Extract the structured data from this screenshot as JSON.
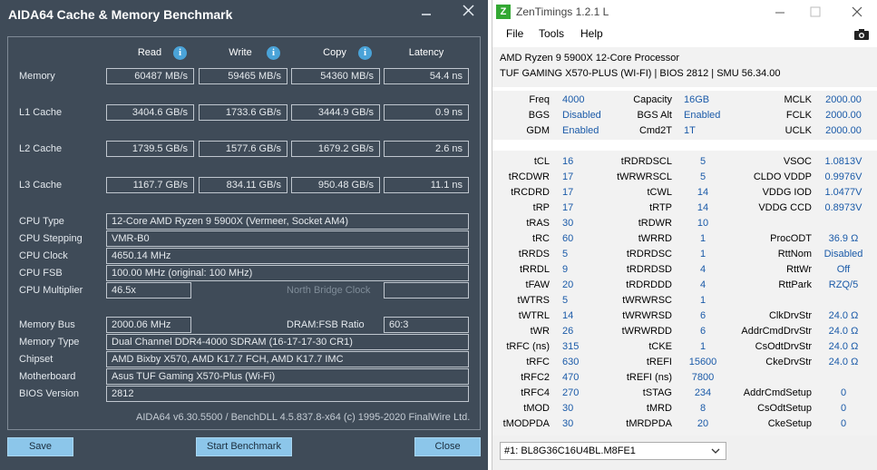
{
  "aida": {
    "title": "AIDA64 Cache & Memory Benchmark",
    "columns": {
      "read": "Read",
      "write": "Write",
      "copy": "Copy",
      "latency": "Latency"
    },
    "info_glyph": "i",
    "rows": [
      {
        "label": "Memory",
        "read": "60487 MB/s",
        "write": "59465 MB/s",
        "copy": "54360 MB/s",
        "latency": "54.4 ns"
      },
      {
        "label": "L1 Cache",
        "read": "3404.6 GB/s",
        "write": "1733.6 GB/s",
        "copy": "3444.9 GB/s",
        "latency": "0.9 ns"
      },
      {
        "label": "L2 Cache",
        "read": "1739.5 GB/s",
        "write": "1577.6 GB/s",
        "copy": "1679.2 GB/s",
        "latency": "2.6 ns"
      },
      {
        "label": "L3 Cache",
        "read": "1167.7 GB/s",
        "write": "834.11 GB/s",
        "copy": "950.48 GB/s",
        "latency": "11.1 ns"
      }
    ],
    "cpu": {
      "type_label": "CPU Type",
      "type": "12-Core AMD Ryzen 9 5900X  (Vermeer, Socket AM4)",
      "stepping_label": "CPU Stepping",
      "stepping": "VMR-B0",
      "clock_label": "CPU Clock",
      "clock": "4650.14 MHz",
      "fsb_label": "CPU FSB",
      "fsb": "100.00 MHz  (original: 100 MHz)",
      "mult_label": "CPU Multiplier",
      "mult": "46.5x",
      "nb_label": "North Bridge Clock"
    },
    "mem": {
      "bus_label": "Memory Bus",
      "bus": "2000.06 MHz",
      "ratio_label": "DRAM:FSB Ratio",
      "ratio": "60:3",
      "type_label": "Memory Type",
      "type": "Dual Channel DDR4-4000 SDRAM  (16-17-17-30 CR1)",
      "chipset_label": "Chipset",
      "chipset": "AMD Bixby X570, AMD K17.7 FCH, AMD K17.7 IMC",
      "mobo_label": "Motherboard",
      "mobo": "Asus TUF Gaming X570-Plus (Wi-Fi)",
      "bios_label": "BIOS Version",
      "bios": "2812"
    },
    "footer": "AIDA64 v6.30.5500 / BenchDLL 4.5.837.8-x64  (c) 1995-2020 FinalWire Ltd.",
    "buttons": {
      "save": "Save",
      "start": "Start Benchmark",
      "close": "Close"
    },
    "colors": {
      "bg": "#3f4b58",
      "button": "#8cc6ea",
      "info": "#4aa3d8"
    }
  },
  "zen": {
    "title": "ZenTimings 1.2.1 L",
    "logo": "Z",
    "menu": [
      "File",
      "Tools",
      "Help"
    ],
    "cpu": "AMD Ryzen 9 5900X 12-Core Processor",
    "board": "TUF GAMING X570-PLUS (WI-FI) | BIOS 2812 | SMU 56.34.00",
    "top": [
      {
        "l1": "Freq",
        "v1": "4000",
        "l2": "Capacity",
        "v2": "16GB",
        "l3": "MCLK",
        "v3": "2000.00"
      },
      {
        "l1": "BGS",
        "v1": "Disabled",
        "l2": "BGS Alt",
        "v2": "Enabled",
        "l3": "FCLK",
        "v3": "2000.00"
      },
      {
        "l1": "GDM",
        "v1": "Enabled",
        "l2": "Cmd2T",
        "v2": "1T",
        "l3": "UCLK",
        "v3": "2000.00"
      }
    ],
    "timings": [
      {
        "l1": "tCL",
        "v1": "16",
        "l2": "tRDRDSCL",
        "v2": "5",
        "l3": "VSOC",
        "v3": "1.0813V"
      },
      {
        "l1": "tRCDWR",
        "v1": "17",
        "l2": "tWRWRSCL",
        "v2": "5",
        "l3": "CLDO VDDP",
        "v3": "0.9976V"
      },
      {
        "l1": "tRCDRD",
        "v1": "17",
        "l2": "tCWL",
        "v2": "14",
        "l3": "VDDG IOD",
        "v3": "1.0477V"
      },
      {
        "l1": "tRP",
        "v1": "17",
        "l2": "tRTP",
        "v2": "14",
        "l3": "VDDG CCD",
        "v3": "0.8973V"
      },
      {
        "l1": "tRAS",
        "v1": "30",
        "l2": "tRDWR",
        "v2": "10",
        "l3": "",
        "v3": ""
      },
      {
        "l1": "tRC",
        "v1": "60",
        "l2": "tWRRD",
        "v2": "1",
        "l3": "ProcODT",
        "v3": "36.9 Ω"
      },
      {
        "l1": "tRRDS",
        "v1": "5",
        "l2": "tRDRDSC",
        "v2": "1",
        "l3": "RttNom",
        "v3": "Disabled"
      },
      {
        "l1": "tRRDL",
        "v1": "9",
        "l2": "tRDRDSD",
        "v2": "4",
        "l3": "RttWr",
        "v3": "Off"
      },
      {
        "l1": "tFAW",
        "v1": "20",
        "l2": "tRDRDDD",
        "v2": "4",
        "l3": "RttPark",
        "v3": "RZQ/5"
      },
      {
        "l1": "tWTRS",
        "v1": "5",
        "l2": "tWRWRSC",
        "v2": "1",
        "l3": "",
        "v3": ""
      },
      {
        "l1": "tWTRL",
        "v1": "14",
        "l2": "tWRWRSD",
        "v2": "6",
        "l3": "ClkDrvStr",
        "v3": "24.0 Ω"
      },
      {
        "l1": "tWR",
        "v1": "26",
        "l2": "tWRWRDD",
        "v2": "6",
        "l3": "AddrCmdDrvStr",
        "v3": "24.0 Ω"
      },
      {
        "l1": "tRFC (ns)",
        "v1": "315",
        "l2": "tCKE",
        "v2": "1",
        "l3": "CsOdtDrvStr",
        "v3": "24.0 Ω"
      },
      {
        "l1": "tRFC",
        "v1": "630",
        "l2": "tREFI",
        "v2": "15600",
        "l3": "CkeDrvStr",
        "v3": "24.0 Ω"
      },
      {
        "l1": "tRFC2",
        "v1": "470",
        "l2": "tREFI (ns)",
        "v2": "7800",
        "l3": "",
        "v3": ""
      },
      {
        "l1": "tRFC4",
        "v1": "270",
        "l2": "tSTAG",
        "v2": "234",
        "l3": "AddrCmdSetup",
        "v3": "0"
      },
      {
        "l1": "tMOD",
        "v1": "30",
        "l2": "tMRD",
        "v2": "8",
        "l3": "CsOdtSetup",
        "v3": "0"
      },
      {
        "l1": "tMODPDA",
        "v1": "30",
        "l2": "tMRDPDA",
        "v2": "20",
        "l3": "CkeSetup",
        "v3": "0"
      }
    ],
    "module": "#1: BL8G36C16U4BL.M8FE1",
    "icons": {
      "screenshot": "camera-icon",
      "dropdown": "chevron-down-icon"
    },
    "colors": {
      "value": "#1a5aa8",
      "logo": "#33a833"
    }
  }
}
